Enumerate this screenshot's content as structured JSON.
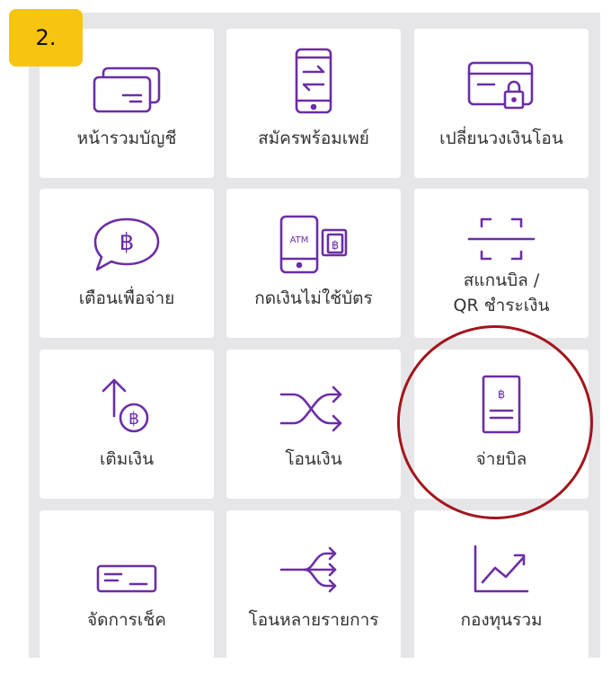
{
  "step_badge": "2.",
  "accent_color": "#6b2ea6",
  "highlight_color": "#a2161c",
  "menu": {
    "items": [
      {
        "label": "หน้ารวมบัญชี",
        "icon": "account-card-icon"
      },
      {
        "label": "สมัครพร้อมเพย์",
        "icon": "phone-transfer-icon"
      },
      {
        "label": "เปลี่ยนวงเงินโอน",
        "icon": "card-lock-icon"
      },
      {
        "label": "เตือนเพื่อจ่าย",
        "icon": "baht-speech-bubble-icon"
      },
      {
        "label": "กดเงินไม่ใช้บัตร",
        "icon": "atm-phone-icon",
        "icon_text": "ATM",
        "baht": "฿"
      },
      {
        "label": "สแกนบิล /\nQR ชำระเงิน",
        "icon": "scan-frame-icon"
      },
      {
        "label": "เติมเงิน",
        "icon": "topup-baht-icon",
        "baht": "฿"
      },
      {
        "label": "โอนเงิน",
        "icon": "shuffle-arrows-icon"
      },
      {
        "label": "จ่ายบิล",
        "icon": "bill-document-icon",
        "baht": "฿"
      },
      {
        "label": "จัดการเช็ค",
        "icon": "cheque-icon"
      },
      {
        "label": "โอนหลายรายการ",
        "icon": "multi-transfer-icon"
      },
      {
        "label": "กองทุนรวม",
        "icon": "chart-trend-icon"
      }
    ]
  }
}
